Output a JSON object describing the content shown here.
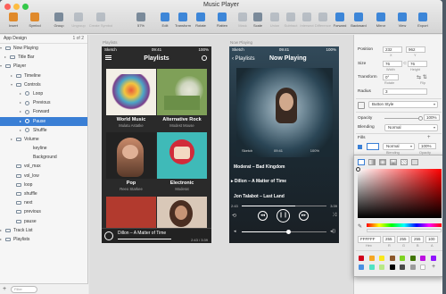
{
  "window": {
    "title": "Music Player"
  },
  "toolbar": {
    "items": [
      {
        "label": "Insert",
        "icon": "insert-icon"
      },
      {
        "label": "Symbol",
        "icon": "symbol-icon"
      },
      {
        "label": "Group",
        "icon": "group-icon"
      },
      {
        "label": "Ungroup",
        "icon": "ungroup-icon"
      },
      {
        "label": "Create Symbol",
        "icon": "create-symbol-icon"
      },
      {
        "label": "57%",
        "icon": "zoom-icon"
      },
      {
        "label": "Edit",
        "icon": "edit-icon"
      },
      {
        "label": "Transform",
        "icon": "transform-icon"
      },
      {
        "label": "Rotate",
        "icon": "rotate-icon"
      },
      {
        "label": "Flatten",
        "icon": "flatten-icon"
      },
      {
        "label": "Mask",
        "icon": "mask-icon"
      },
      {
        "label": "Scale",
        "icon": "scale-icon"
      },
      {
        "label": "Union",
        "icon": "union-icon"
      },
      {
        "label": "Subtract",
        "icon": "subtract-icon"
      },
      {
        "label": "Intersect",
        "icon": "intersect-icon"
      },
      {
        "label": "Difference",
        "icon": "difference-icon"
      },
      {
        "label": "Forward",
        "icon": "forward-icon"
      },
      {
        "label": "Backward",
        "icon": "backward-icon"
      },
      {
        "label": "Mirror",
        "icon": "mirror-icon"
      },
      {
        "label": "View",
        "icon": "view-icon"
      },
      {
        "label": "Export",
        "icon": "export-icon"
      }
    ]
  },
  "sidebar": {
    "header": "App Design",
    "page": "1 of 2",
    "filter_placeholder": "Filter",
    "items": [
      {
        "label": "Now Playing"
      },
      {
        "label": "Title Bar"
      },
      {
        "label": "Player"
      },
      {
        "label": "Timeline"
      },
      {
        "label": "Controls"
      },
      {
        "label": "Loop"
      },
      {
        "label": "Previous"
      },
      {
        "label": "Forward"
      },
      {
        "label": "Pause"
      },
      {
        "label": "Shuffle"
      },
      {
        "label": "Volume"
      },
      {
        "label": "keyline"
      },
      {
        "label": "Background"
      },
      {
        "label": "vol_max"
      },
      {
        "label": "vol_low"
      },
      {
        "label": "loop"
      },
      {
        "label": "shuffle"
      },
      {
        "label": "next"
      },
      {
        "label": "previous"
      },
      {
        "label": "pause"
      },
      {
        "label": "Track List"
      },
      {
        "label": "Playlists"
      }
    ]
  },
  "canvas": {
    "artboard1": {
      "label": "Playlists",
      "status": {
        "carrier": "Sketch",
        "time": "09:41",
        "battery": "100%"
      },
      "title": "Playlists",
      "tiles": [
        {
          "name": "World Music",
          "sub": "Mulatu Astatke"
        },
        {
          "name": "Alternative Rock",
          "sub": "Modest Mouse"
        },
        {
          "name": "Pop",
          "sub": "Reeo Starkee"
        },
        {
          "name": "Electronic",
          "sub": "Moderat"
        }
      ],
      "mini_player": {
        "track": "Dillon – A Matter of Time",
        "time": "2:43 / 3:39"
      }
    },
    "artboard2": {
      "label": "Now Playing",
      "status": {
        "carrier": "Sketch",
        "time": "09:41",
        "battery": "100%"
      },
      "back": "Playlists",
      "title": "Now Playing",
      "tracks": [
        "Moderat – Bad Kingdom",
        "Dillon – A Matter of Time",
        "Jon Talabot – Last Land"
      ],
      "time_elapsed": "2:43",
      "time_total": "3:39",
      "overlay_status": {
        "carrier": "Sketch",
        "time": "09:41",
        "battery": "100%"
      }
    }
  },
  "inspector": {
    "position_label": "Position",
    "pos_x": "232",
    "pos_y": "962",
    "x_label": "X",
    "y_label": "Y",
    "size_label": "Size",
    "w": "76",
    "h": "76",
    "w_label": "Width",
    "h_label": "Height",
    "transform_label": "Transform",
    "rotate": "0°",
    "rotate_label": "Rotate",
    "flip_label": "Flip",
    "radius_label": "Radius",
    "radius": "3",
    "style": "Button Style",
    "opacity_label": "Opacity",
    "opacity": "100%",
    "blending_label": "Blending",
    "blending": "Normal",
    "fills_label": "Fills",
    "fill_blend": "Normal",
    "fill_opacity": "100%",
    "blending_sub": "Blending",
    "opacity_sub": "Opacity"
  },
  "color_picker": {
    "hex": "FFFFFF",
    "r": "255",
    "g": "255",
    "b": "255",
    "a": "100",
    "hex_label": "Hex",
    "r_label": "R",
    "g_label": "G",
    "b_label": "B",
    "a_label": "A",
    "swatches": [
      "#d0021b",
      "#f5a623",
      "#f8e71c",
      "#8b572a",
      "#7ed321",
      "#417505",
      "#bd10e0",
      "#9013fe",
      "#4a90e2",
      "#50e3c2",
      "#b8e986",
      "#000000",
      "#4a4a4a",
      "#9b9b9b",
      "#ffffff"
    ]
  }
}
